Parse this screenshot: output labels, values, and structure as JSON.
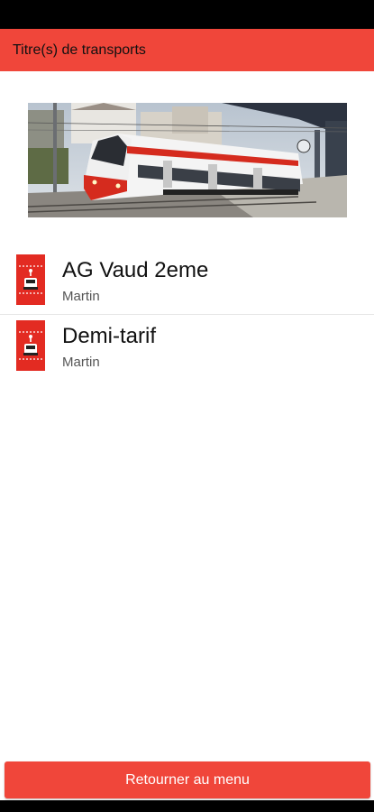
{
  "app_bar": {
    "title": "Titre(s) de transports"
  },
  "colors": {
    "accent": "#f0463a",
    "status_bar": "#000000"
  },
  "hero": {
    "icon": "train-photo"
  },
  "tickets": [
    {
      "name": "AG Vaud 2eme",
      "owner": "Martin",
      "icon": "train-ticket-icon"
    },
    {
      "name": "Demi-tarif",
      "owner": "Martin",
      "icon": "train-ticket-icon"
    }
  ],
  "footer": {
    "button_label": "Retourner au menu"
  }
}
